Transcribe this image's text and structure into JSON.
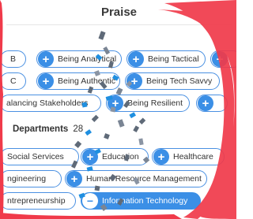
{
  "title": "Praise",
  "skills": {
    "row1": [
      "B",
      "Being Analytical",
      "Being Tactical"
    ],
    "row2": [
      "C",
      "Being Authentic",
      "Being Tech Savvy"
    ],
    "row3": [
      "alancing Stakeholders",
      "Being Resilient"
    ]
  },
  "departments": {
    "heading": "Departments",
    "count": "28",
    "row1": [
      "Social Services",
      "Education",
      "Healthcare"
    ],
    "row2": [
      "ngineering",
      "Human Resource Management"
    ],
    "row3": [
      "ntrepreneurship",
      "Information Technology"
    ]
  },
  "icons": {
    "add": "+",
    "remove": "−"
  },
  "colors": {
    "accent": "#3b8fe6",
    "annotation": "#f03a4a",
    "confetti": "#5f6a78"
  }
}
